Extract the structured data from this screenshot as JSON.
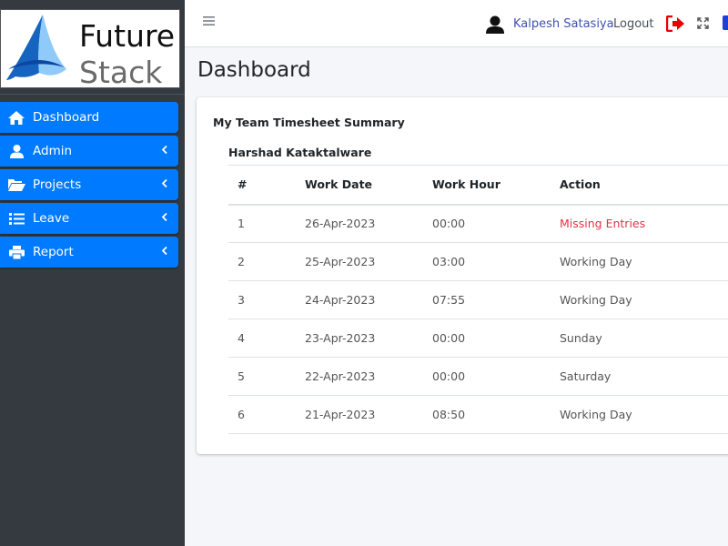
{
  "brand": {
    "line1": "Future",
    "line2": "Stack"
  },
  "sidebar": {
    "items": [
      {
        "label": "Dashboard",
        "icon": "home-icon"
      },
      {
        "label": "Admin",
        "icon": "user-icon"
      },
      {
        "label": "Projects",
        "icon": "folder-open-icon"
      },
      {
        "label": "Leave",
        "icon": "list-icon"
      },
      {
        "label": "Report",
        "icon": "print-icon"
      }
    ]
  },
  "header": {
    "user_name": "Kalpesh Satasiya",
    "logout_label": "Logout"
  },
  "page": {
    "title": "Dashboard"
  },
  "card": {
    "title": "My Team Timesheet Summary",
    "member": "Harshad Kataktalware",
    "columns": [
      "#",
      "Work Date",
      "Work Hour",
      "Action"
    ],
    "rows": [
      {
        "num": "1",
        "date": "26-Apr-2023",
        "hour": "00:00",
        "action": "Missing Entries"
      },
      {
        "num": "2",
        "date": "25-Apr-2023",
        "hour": "03:00",
        "action": "Working Day"
      },
      {
        "num": "3",
        "date": "24-Apr-2023",
        "hour": "07:55",
        "action": "Working Day"
      },
      {
        "num": "4",
        "date": "23-Apr-2023",
        "hour": "00:00",
        "action": "Sunday"
      },
      {
        "num": "5",
        "date": "22-Apr-2023",
        "hour": "00:00",
        "action": "Saturday"
      },
      {
        "num": "6",
        "date": "21-Apr-2023",
        "hour": "08:50",
        "action": "Working Day"
      }
    ]
  },
  "colors": {
    "sidebar_bg": "#343a40",
    "nav_active": "#007bff",
    "user_link": "#3f51b5",
    "missing": "#dc3545",
    "exit_icon": "#e60000"
  }
}
